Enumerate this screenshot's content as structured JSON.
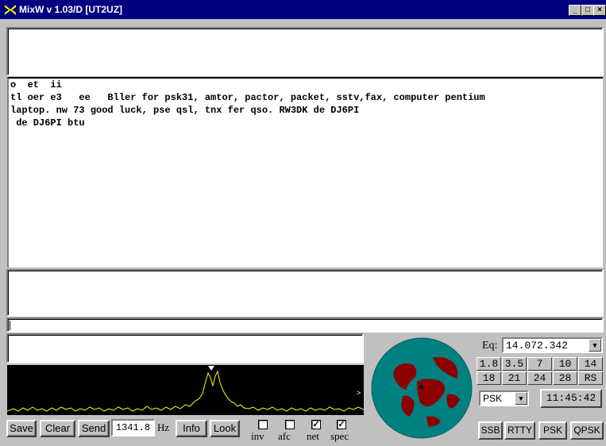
{
  "window": {
    "title": "MixW v 1.03/D [UT2UZ]"
  },
  "rx_lines": [
    "o  et  ii",
    "tl oer e3   ee   Bller for psk31, amtor, pactor, packet, sstv,fax, computer pentium",
    "laptop. nw 73 good luck, pse qsl, tnx fer qso. RW3DK de DJ6PI",
    " de DJ6PI btu"
  ],
  "buttons": {
    "save": "Save",
    "clear": "Clear",
    "send": "Send",
    "info": "Info",
    "look": "Look"
  },
  "audio_freq": "1341.8",
  "audio_unit": "Hz",
  "checkboxes": [
    {
      "label": "inv",
      "checked": false
    },
    {
      "label": "afc",
      "checked": false
    },
    {
      "label": "net",
      "checked": true
    },
    {
      "label": "spec",
      "checked": true
    }
  ],
  "eq_label": "Eq:",
  "frequency": "14.072.342",
  "bands": [
    "1.8",
    "3.5",
    "7",
    "10",
    "14",
    "18",
    "21",
    "24",
    "28",
    "RS"
  ],
  "mode_select": "PSK",
  "clock": "11:45:42",
  "mode_buttons": [
    "SSB",
    "RTTY",
    "PSK",
    "QPSK"
  ],
  "colors": {
    "title_bg": "#000080",
    "spectrum_line": "#ffff00",
    "ocean": "#008080",
    "land": "#8b0000"
  }
}
